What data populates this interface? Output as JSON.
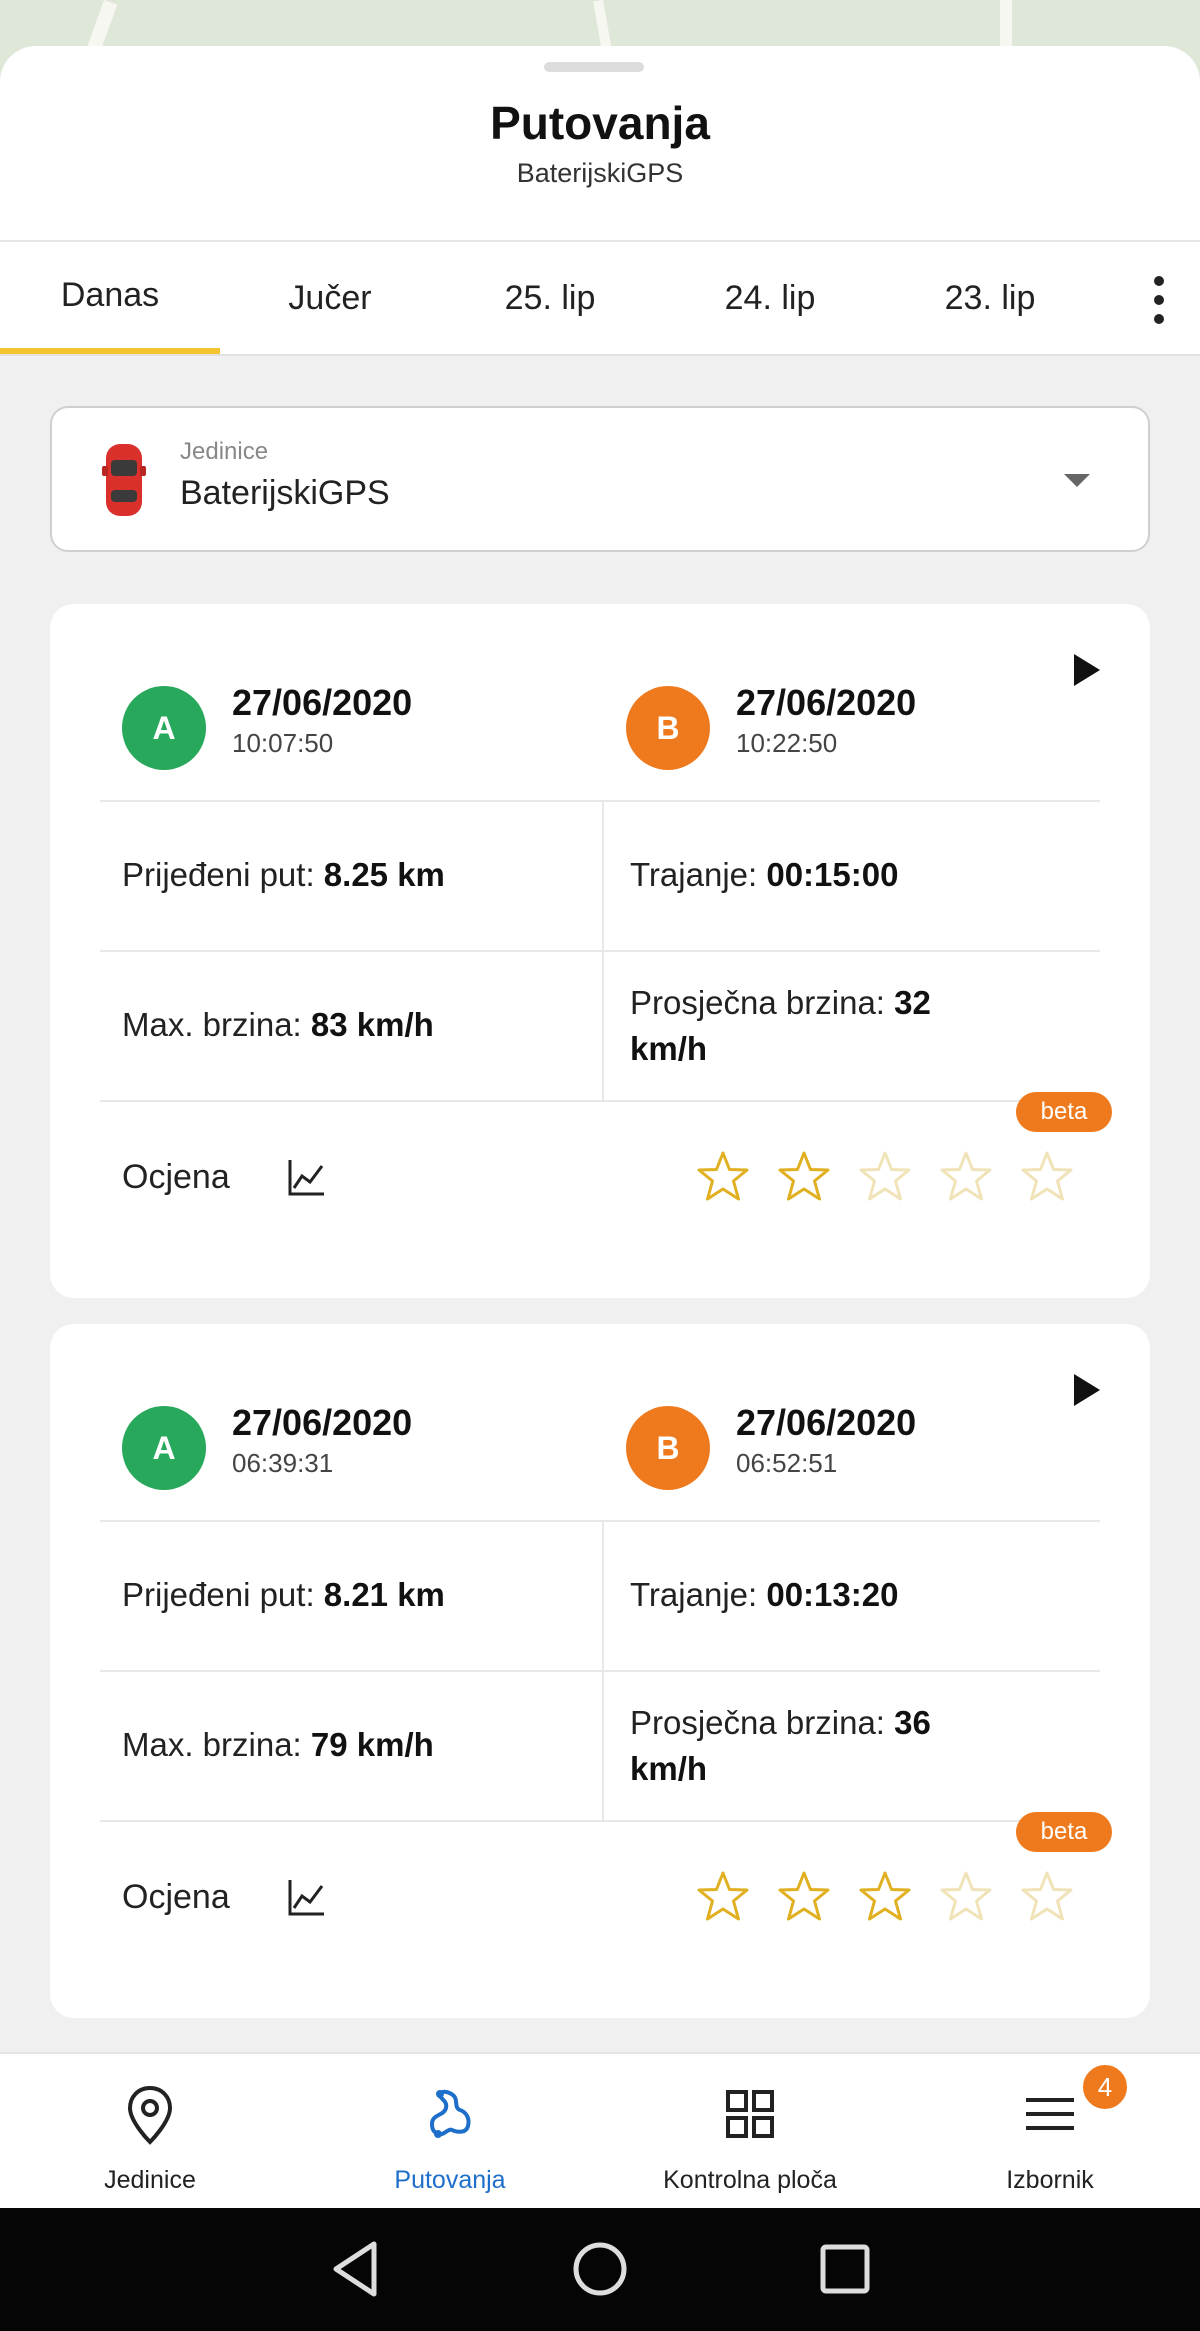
{
  "sheet": {
    "title": "Putovanja",
    "subtitle": "BaterijskiGPS"
  },
  "tabs": [
    {
      "label": "Danas",
      "active": true
    },
    {
      "label": "Jučer",
      "active": false
    },
    {
      "label": "25. lip",
      "active": false
    },
    {
      "label": "24. lip",
      "active": false
    },
    {
      "label": "23. lip",
      "active": false
    }
  ],
  "unit_select": {
    "label": "Jedinice",
    "value": "BaterijskiGPS",
    "icon": "car-icon"
  },
  "trips": [
    {
      "start": {
        "badge": "A",
        "date": "27/06/2020",
        "time": "10:07:50"
      },
      "end": {
        "badge": "B",
        "date": "27/06/2020",
        "time": "10:22:50"
      },
      "distance_label": "Prijeđeni put: ",
      "distance_value": "8.25 km",
      "duration_label": "Trajanje: ",
      "duration_value": "00:15:00",
      "max_speed_label": "Max. brzina: ",
      "max_speed_value": "83 km/h",
      "avg_speed_label": "Prosječna brzina: ",
      "avg_speed_value": "32",
      "avg_speed_unit": "km/h",
      "rating_label": "Ocjena",
      "beta_label": "beta",
      "rating_stars": 2,
      "rating_max": 5
    },
    {
      "start": {
        "badge": "A",
        "date": "27/06/2020",
        "time": "06:39:31"
      },
      "end": {
        "badge": "B",
        "date": "27/06/2020",
        "time": "06:52:51"
      },
      "distance_label": "Prijeđeni put: ",
      "distance_value": "8.21 km",
      "duration_label": "Trajanje: ",
      "duration_value": "00:13:20",
      "max_speed_label": "Max. brzina: ",
      "max_speed_value": "79 km/h",
      "avg_speed_label": "Prosječna brzina: ",
      "avg_speed_value": "36",
      "avg_speed_unit": "km/h",
      "rating_label": "Ocjena",
      "beta_label": "beta",
      "rating_stars": 3,
      "rating_max": 5
    }
  ],
  "bottom_nav": {
    "items": [
      {
        "label": "Jedinice",
        "icon": "map-pin-icon",
        "active": false
      },
      {
        "label": "Putovanja",
        "icon": "route-icon",
        "active": true
      },
      {
        "label": "Kontrolna ploča",
        "icon": "dashboard-grid-icon",
        "active": false
      },
      {
        "label": "Izbornik",
        "icon": "hamburger-menu-icon",
        "active": false
      }
    ],
    "menu_badge": "4"
  },
  "colors": {
    "accent_tab": "#f4c531",
    "point_a": "#27a85a",
    "point_b": "#ef7a1e",
    "star": "#e0b020",
    "nav_active": "#1e6fc9"
  }
}
